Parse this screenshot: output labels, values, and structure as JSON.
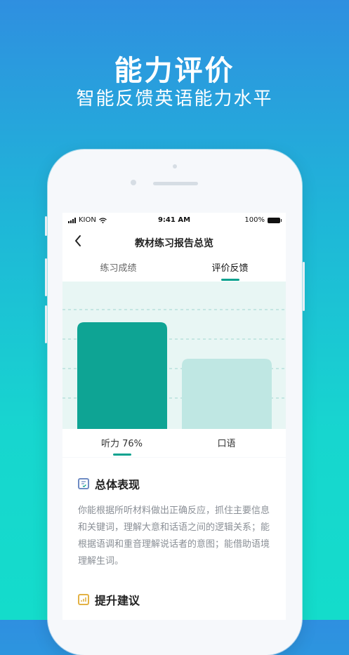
{
  "hero": {
    "title": "能力评价",
    "subtitle": "智能反馈英语能力水平"
  },
  "status_bar": {
    "carrier": "KION",
    "time": "9:41 AM",
    "battery": "100%"
  },
  "nav": {
    "title": "教材练习报告总览"
  },
  "tabs": [
    {
      "label": "练习成绩"
    },
    {
      "label": "评价反馈"
    }
  ],
  "active_tab_index": 1,
  "chart_data": {
    "type": "bar",
    "categories": [
      "听力 76%",
      "口语"
    ],
    "values": [
      76,
      50
    ],
    "ylim": [
      0,
      100
    ],
    "grid": true,
    "colors": [
      "#0ea494",
      "#bfe7e3"
    ]
  },
  "chart_tabs": [
    {
      "label": "听力 76%"
    },
    {
      "label": "口语"
    }
  ],
  "overall": {
    "title": "总体表现",
    "text": "你能根据所听材料做出正确反应，抓住主要信息和关键词，理解大意和话语之间的逻辑关系；能根据语调和重音理解说话者的意图；能借助语境理解生词。"
  },
  "suggest": {
    "title": "提升建议"
  },
  "colors": {
    "accent": "#0aa28f",
    "accent_light": "#bfe7e3"
  }
}
